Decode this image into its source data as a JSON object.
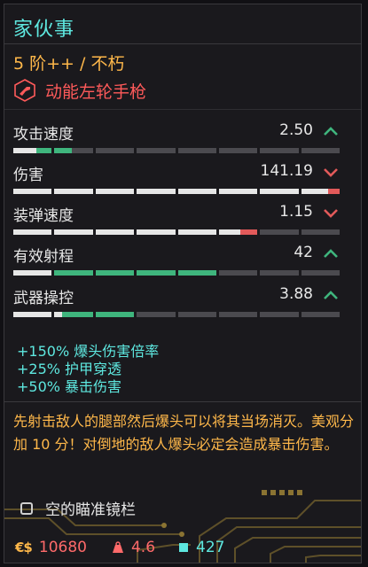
{
  "title": "家伙事",
  "tier": "5 阶++ / 不朽",
  "weapon_type": {
    "label": "动能左轮手枪",
    "icon": "revolver-icon"
  },
  "colors": {
    "cyan": "#5ee8e0",
    "orange": "#ffb84a",
    "red": "#ff5a5a",
    "bar_white": "#e6e6e6",
    "bar_green": "#3fb57d",
    "bar_red": "#e25a5a",
    "bar_empty": "#4b4a4f"
  },
  "stats": [
    {
      "label": "攻击速度",
      "value": "2.50",
      "trend": "up",
      "segments": [
        [
          1,
          0.6,
          "#e6e6e6",
          0.4,
          "#3fb57d"
        ],
        [
          0.45,
          0,
          "#e6e6e6",
          0.45,
          "#3fb57d"
        ],
        [
          0,
          0,
          "",
          0,
          ""
        ],
        [
          0,
          0,
          "",
          0,
          ""
        ],
        [
          0,
          0,
          "",
          0,
          ""
        ],
        [
          0,
          0,
          "",
          0,
          ""
        ],
        [
          0,
          0,
          "",
          0,
          ""
        ],
        [
          0,
          0,
          "",
          0,
          ""
        ]
      ]
    },
    {
      "label": "伤害",
      "value": "141.19",
      "trend": "down",
      "segments": [
        [
          1,
          1,
          "#e6e6e6",
          0,
          ""
        ],
        [
          1,
          1,
          "#e6e6e6",
          0,
          ""
        ],
        [
          1,
          1,
          "#e6e6e6",
          0,
          ""
        ],
        [
          1,
          1,
          "#e6e6e6",
          0,
          ""
        ],
        [
          1,
          1,
          "#e6e6e6",
          0,
          ""
        ],
        [
          1,
          1,
          "#e6e6e6",
          0,
          ""
        ],
        [
          1,
          1,
          "#e6e6e6",
          0,
          ""
        ],
        [
          1,
          0.7,
          "#e6e6e6",
          0.3,
          "#e25a5a"
        ]
      ]
    },
    {
      "label": "装弹速度",
      "value": "1.15",
      "trend": "down",
      "segments": [
        [
          1,
          1,
          "#e6e6e6",
          0,
          ""
        ],
        [
          1,
          1,
          "#e6e6e6",
          0,
          ""
        ],
        [
          1,
          1,
          "#e6e6e6",
          0,
          ""
        ],
        [
          1,
          1,
          "#e6e6e6",
          0,
          ""
        ],
        [
          1,
          1,
          "#e6e6e6",
          0,
          ""
        ],
        [
          1,
          0.55,
          "#e6e6e6",
          0.45,
          "#e25a5a"
        ],
        [
          0,
          0,
          "",
          0,
          ""
        ],
        [
          0,
          0,
          "",
          0,
          ""
        ]
      ]
    },
    {
      "label": "有效射程",
      "value": "42",
      "trend": "up",
      "segments": [
        [
          1,
          1,
          "#e6e6e6",
          0,
          ""
        ],
        [
          1,
          0,
          "#e6e6e6",
          1,
          "#3fb57d"
        ],
        [
          1,
          0,
          "#e6e6e6",
          1,
          "#3fb57d"
        ],
        [
          1,
          0,
          "#e6e6e6",
          1,
          "#3fb57d"
        ],
        [
          1,
          0,
          "#e6e6e6",
          1,
          "#3fb57d"
        ],
        [
          0,
          0,
          "",
          0,
          ""
        ],
        [
          0,
          0,
          "",
          0,
          ""
        ],
        [
          0,
          0,
          "",
          0,
          ""
        ]
      ]
    },
    {
      "label": "武器操控",
      "value": "3.88",
      "trend": "up",
      "segments": [
        [
          1,
          1,
          "#e6e6e6",
          0,
          ""
        ],
        [
          1,
          0.2,
          "#e6e6e6",
          0.8,
          "#3fb57d"
        ],
        [
          1,
          0,
          "#e6e6e6",
          1,
          "#3fb57d"
        ],
        [
          0,
          0,
          "",
          0,
          ""
        ],
        [
          0,
          0,
          "",
          0,
          ""
        ],
        [
          0,
          0,
          "",
          0,
          ""
        ],
        [
          0,
          0,
          "",
          0,
          ""
        ],
        [
          0,
          0,
          "",
          0,
          ""
        ]
      ]
    }
  ],
  "bonuses": [
    "+150% 爆头伤害倍率",
    "+25% 护甲穿透",
    "+50% 暴击伤害"
  ],
  "description": "先射击敌人的腿部然后爆头可以将其当场消灭。美观分加 10 分！对倒地的敌人爆头必定会造成暴击伤害。",
  "mod_slot": {
    "label": "空的瞄准镜栏",
    "checked": false
  },
  "footer": {
    "money": "10680",
    "money_icon": "€$",
    "weight": "4.6",
    "weight_icon": "weight-icon",
    "components": "427",
    "components_icon": "component-icon"
  }
}
